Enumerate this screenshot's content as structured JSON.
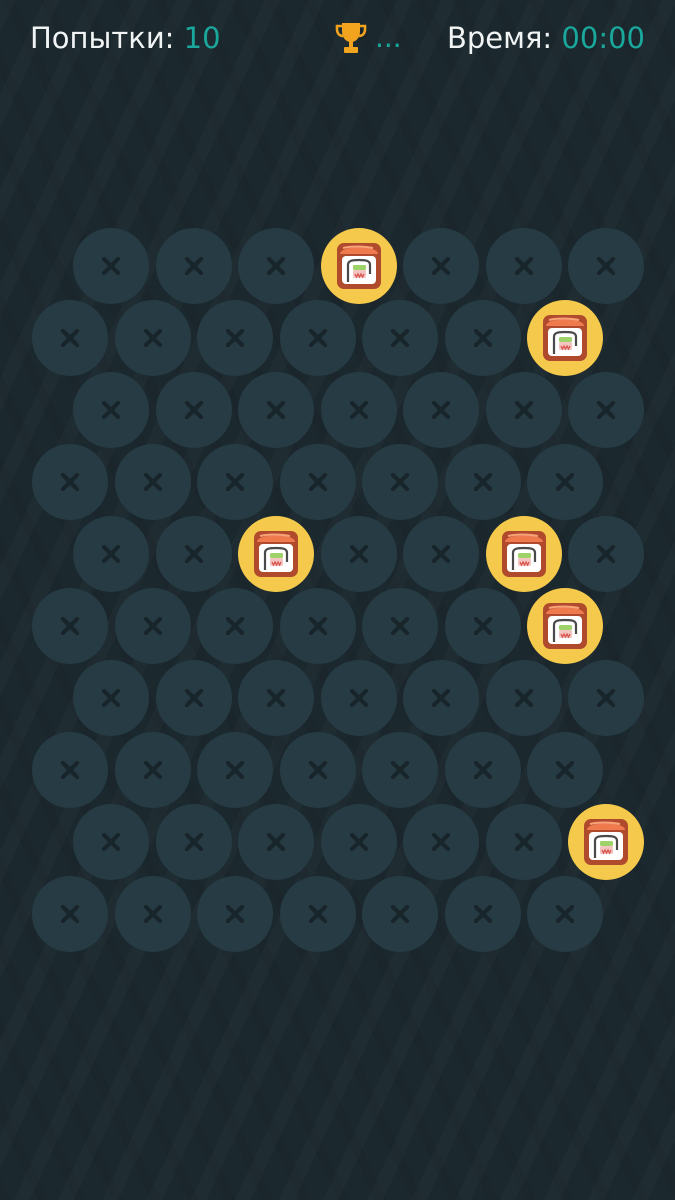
{
  "hud": {
    "attempts_label": "Попытки:",
    "attempts_value": "10",
    "best_icon": "trophy-icon",
    "best_value": "...",
    "time_label": "Время:",
    "time_value": "00:00"
  },
  "board": {
    "rows": 10,
    "long_row_count": 7,
    "short_row_count": 7,
    "closed_icon": "cross-icon",
    "open_icon": "sushi-roll-icon",
    "opened_cells": [
      {
        "row": 0,
        "col": 3
      },
      {
        "row": 1,
        "col": 6
      },
      {
        "row": 4,
        "col": 2
      },
      {
        "row": 4,
        "col": 5
      },
      {
        "row": 5,
        "col": 6
      },
      {
        "row": 8,
        "col": 6
      }
    ]
  },
  "colors": {
    "background": "#1b282d",
    "cell_closed": "#263b44",
    "cell_open": "#f5c94b",
    "cross": "#18252a",
    "accent": "#1aa79c",
    "trophy": "#f2a41f"
  }
}
